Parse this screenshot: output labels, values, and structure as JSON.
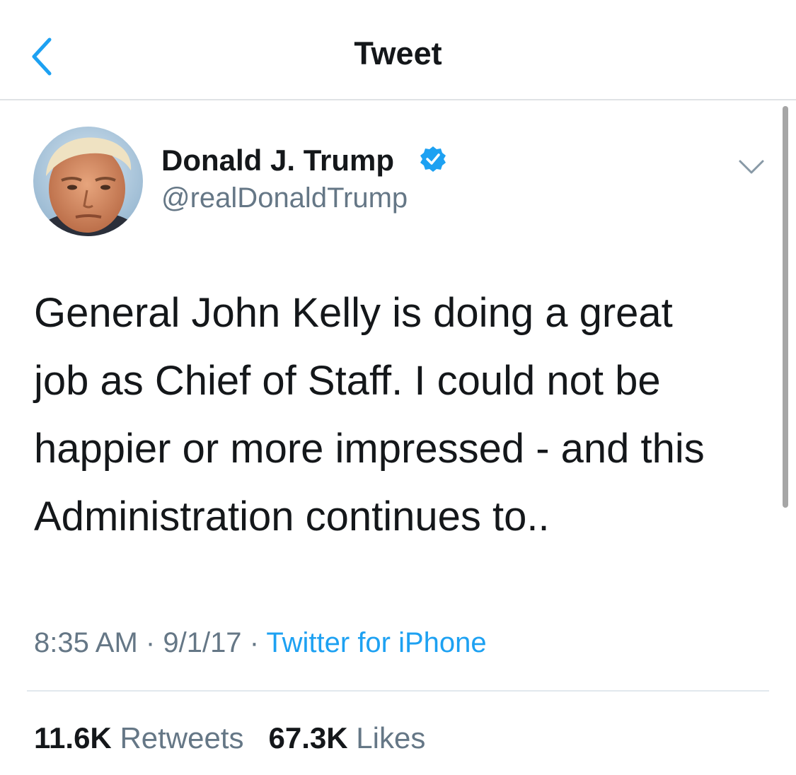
{
  "nav": {
    "back_icon": "chevron-left-icon",
    "title": "Tweet"
  },
  "colors": {
    "accent": "#1da1f2",
    "text": "#14171a",
    "secondary": "#657786",
    "divider": "#e1e8ed"
  },
  "tweet": {
    "author": {
      "name": "Donald J. Trump",
      "handle": "@realDonaldTrump",
      "verified": true,
      "avatar": "profile-photo"
    },
    "text_lines": [
      "General John Kelly is doing a great",
      "job as Chief of Staff. I could not be",
      "happier or more impressed - and this",
      "Administration continues to.."
    ],
    "time": "8:35 AM",
    "date": "9/1/17",
    "separator": "·",
    "source": "Twitter for iPhone",
    "retweets_count": "11.6K",
    "retweets_label": "Retweets",
    "likes_count": "67.3K",
    "likes_label": "Likes"
  }
}
